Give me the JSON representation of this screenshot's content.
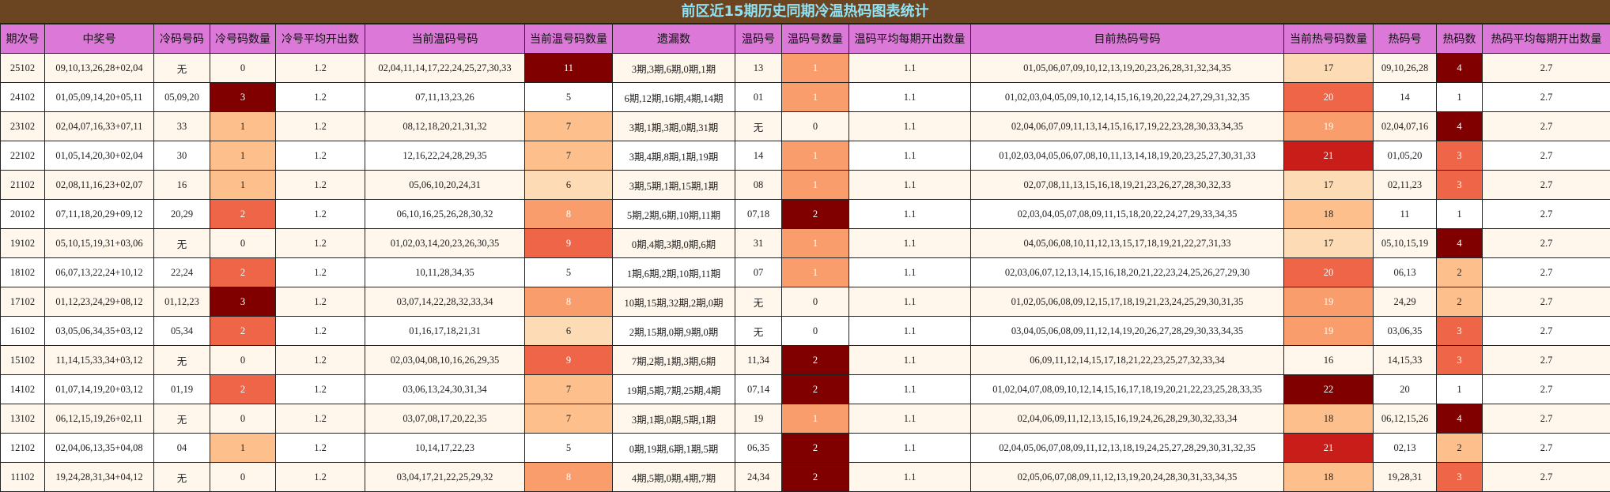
{
  "title": "前区近15期历史同期冷温热码图表统计",
  "headers": [
    "期次号",
    "中奖号",
    "冷码号码",
    "冷号码数量",
    "冷号平均开出数",
    "当前温码号码",
    "当前温号码数量",
    "遗漏数",
    "温码号",
    "温码号数量",
    "温码平均每期开出数量",
    "目前热码号码",
    "当前热号码数量",
    "热码号",
    "热码数",
    "热码平均每期开出数量"
  ],
  "colors": {
    "c1": "#fddcb5",
    "c2": "#fdc08c",
    "c3": "#fa9d6c",
    "c4": "#ee6548",
    "c5": "#c81d19",
    "c6": "#800000",
    "blank": "#ffffff"
  },
  "rows": [
    {
      "issue": "25102",
      "win": "09,10,13,26,28+02,04",
      "cold": "无",
      "cold_n": "0",
      "cold_avg": "1.2",
      "warm": "02,04,11,14,17,22,24,25,27,30,33",
      "warm_n": "11",
      "miss": "3期,3期,6期,0期,1期",
      "wcode": "13",
      "wcode_n": "1",
      "wcode_avg": "1.1",
      "hot": "01,05,06,07,09,10,12,13,19,20,23,26,28,31,32,34,35",
      "hot_n": "17",
      "hcode": "09,10,26,28",
      "hcode_n": "4",
      "hcode_avg": "2.7"
    },
    {
      "issue": "24102",
      "win": "01,05,09,14,20+05,11",
      "cold": "05,09,20",
      "cold_n": "3",
      "cold_avg": "1.2",
      "warm": "07,11,13,23,26",
      "warm_n": "5",
      "miss": "6期,12期,16期,4期,14期",
      "wcode": "01",
      "wcode_n": "1",
      "wcode_avg": "1.1",
      "hot": "01,02,03,04,05,09,10,12,14,15,16,19,20,22,24,27,29,31,32,35",
      "hot_n": "20",
      "hcode": "14",
      "hcode_n": "1",
      "hcode_avg": "2.7"
    },
    {
      "issue": "23102",
      "win": "02,04,07,16,33+07,11",
      "cold": "33",
      "cold_n": "1",
      "cold_avg": "1.2",
      "warm": "08,12,18,20,21,31,32",
      "warm_n": "7",
      "miss": "3期,1期,3期,0期,31期",
      "wcode": "无",
      "wcode_n": "0",
      "wcode_avg": "1.1",
      "hot": "02,04,06,07,09,11,13,14,15,16,17,19,22,23,28,30,33,34,35",
      "hot_n": "19",
      "hcode": "02,04,07,16",
      "hcode_n": "4",
      "hcode_avg": "2.7"
    },
    {
      "issue": "22102",
      "win": "01,05,14,20,30+02,04",
      "cold": "30",
      "cold_n": "1",
      "cold_avg": "1.2",
      "warm": "12,16,22,24,28,29,35",
      "warm_n": "7",
      "miss": "3期,4期,8期,1期,19期",
      "wcode": "14",
      "wcode_n": "1",
      "wcode_avg": "1.1",
      "hot": "01,02,03,04,05,06,07,08,10,11,13,14,18,19,20,23,25,27,30,31,33",
      "hot_n": "21",
      "hcode": "01,05,20",
      "hcode_n": "3",
      "hcode_avg": "2.7"
    },
    {
      "issue": "21102",
      "win": "02,08,11,16,23+02,07",
      "cold": "16",
      "cold_n": "1",
      "cold_avg": "1.2",
      "warm": "05,06,10,20,24,31",
      "warm_n": "6",
      "miss": "3期,5期,1期,15期,1期",
      "wcode": "08",
      "wcode_n": "1",
      "wcode_avg": "1.1",
      "hot": "02,07,08,11,13,15,16,18,19,21,23,26,27,28,30,32,33",
      "hot_n": "17",
      "hcode": "02,11,23",
      "hcode_n": "3",
      "hcode_avg": "2.7"
    },
    {
      "issue": "20102",
      "win": "07,11,18,20,29+09,12",
      "cold": "20,29",
      "cold_n": "2",
      "cold_avg": "1.2",
      "warm": "06,10,16,25,26,28,30,32",
      "warm_n": "8",
      "miss": "5期,2期,6期,10期,11期",
      "wcode": "07,18",
      "wcode_n": "2",
      "wcode_avg": "1.1",
      "hot": "02,03,04,05,07,08,09,11,15,18,20,22,24,27,29,33,34,35",
      "hot_n": "18",
      "hcode": "11",
      "hcode_n": "1",
      "hcode_avg": "2.7"
    },
    {
      "issue": "19102",
      "win": "05,10,15,19,31+03,06",
      "cold": "无",
      "cold_n": "0",
      "cold_avg": "1.2",
      "warm": "01,02,03,14,20,23,26,30,35",
      "warm_n": "9",
      "miss": "0期,4期,3期,0期,6期",
      "wcode": "31",
      "wcode_n": "1",
      "wcode_avg": "1.1",
      "hot": "04,05,06,08,10,11,12,13,15,17,18,19,21,22,27,31,33",
      "hot_n": "17",
      "hcode": "05,10,15,19",
      "hcode_n": "4",
      "hcode_avg": "2.7"
    },
    {
      "issue": "18102",
      "win": "06,07,13,22,24+10,12",
      "cold": "22,24",
      "cold_n": "2",
      "cold_avg": "1.2",
      "warm": "10,11,28,34,35",
      "warm_n": "5",
      "miss": "1期,6期,2期,10期,11期",
      "wcode": "07",
      "wcode_n": "1",
      "wcode_avg": "1.1",
      "hot": "02,03,06,07,12,13,14,15,16,18,20,21,22,23,24,25,26,27,29,30",
      "hot_n": "20",
      "hcode": "06,13",
      "hcode_n": "2",
      "hcode_avg": "2.7"
    },
    {
      "issue": "17102",
      "win": "01,12,23,24,29+08,12",
      "cold": "01,12,23",
      "cold_n": "3",
      "cold_avg": "1.2",
      "warm": "03,07,14,22,28,32,33,34",
      "warm_n": "8",
      "miss": "10期,15期,32期,2期,0期",
      "wcode": "无",
      "wcode_n": "0",
      "wcode_avg": "1.1",
      "hot": "01,02,05,06,08,09,12,15,17,18,19,21,23,24,25,29,30,31,35",
      "hot_n": "19",
      "hcode": "24,29",
      "hcode_n": "2",
      "hcode_avg": "2.7"
    },
    {
      "issue": "16102",
      "win": "03,05,06,34,35+03,12",
      "cold": "05,34",
      "cold_n": "2",
      "cold_avg": "1.2",
      "warm": "01,16,17,18,21,31",
      "warm_n": "6",
      "miss": "2期,15期,0期,9期,0期",
      "wcode": "无",
      "wcode_n": "0",
      "wcode_avg": "1.1",
      "hot": "03,04,05,06,08,09,11,12,14,19,20,26,27,28,29,30,33,34,35",
      "hot_n": "19",
      "hcode": "03,06,35",
      "hcode_n": "3",
      "hcode_avg": "2.7"
    },
    {
      "issue": "15102",
      "win": "11,14,15,33,34+03,12",
      "cold": "无",
      "cold_n": "0",
      "cold_avg": "1.2",
      "warm": "02,03,04,08,10,16,26,29,35",
      "warm_n": "9",
      "miss": "7期,2期,1期,3期,6期",
      "wcode": "11,34",
      "wcode_n": "2",
      "wcode_avg": "1.1",
      "hot": "06,09,11,12,14,15,17,18,21,22,23,25,27,32,33,34",
      "hot_n": "16",
      "hcode": "14,15,33",
      "hcode_n": "3",
      "hcode_avg": "2.7"
    },
    {
      "issue": "14102",
      "win": "01,07,14,19,20+03,12",
      "cold": "01,19",
      "cold_n": "2",
      "cold_avg": "1.2",
      "warm": "03,06,13,24,30,31,34",
      "warm_n": "7",
      "miss": "19期,5期,7期,25期,4期",
      "wcode": "07,14",
      "wcode_n": "2",
      "wcode_avg": "1.1",
      "hot": "01,02,04,07,08,09,10,12,14,15,16,17,18,19,20,21,22,23,25,28,33,35",
      "hot_n": "22",
      "hcode": "20",
      "hcode_n": "1",
      "hcode_avg": "2.7"
    },
    {
      "issue": "13102",
      "win": "06,12,15,19,26+02,11",
      "cold": "无",
      "cold_n": "0",
      "cold_avg": "1.2",
      "warm": "03,07,08,17,20,22,35",
      "warm_n": "7",
      "miss": "3期,1期,0期,5期,1期",
      "wcode": "19",
      "wcode_n": "1",
      "wcode_avg": "1.1",
      "hot": "02,04,06,09,11,12,13,15,16,19,24,26,28,29,30,32,33,34",
      "hot_n": "18",
      "hcode": "06,12,15,26",
      "hcode_n": "4",
      "hcode_avg": "2.7"
    },
    {
      "issue": "12102",
      "win": "02,04,06,13,35+04,08",
      "cold": "04",
      "cold_n": "1",
      "cold_avg": "1.2",
      "warm": "10,14,17,22,23",
      "warm_n": "5",
      "miss": "0期,19期,6期,1期,5期",
      "wcode": "06,35",
      "wcode_n": "2",
      "wcode_avg": "1.1",
      "hot": "02,04,05,06,07,08,09,11,12,13,18,19,24,25,27,28,29,30,31,32,35",
      "hot_n": "21",
      "hcode": "02,13",
      "hcode_n": "2",
      "hcode_avg": "2.7"
    },
    {
      "issue": "11102",
      "win": "19,24,28,31,34+04,12",
      "cold": "无",
      "cold_n": "0",
      "cold_avg": "1.2",
      "warm": "03,04,17,21,22,25,29,32",
      "warm_n": "8",
      "miss": "4期,5期,0期,4期,7期",
      "wcode": "24,34",
      "wcode_n": "2",
      "wcode_avg": "1.1",
      "hot": "02,05,06,07,08,09,11,12,13,19,20,24,28,30,31,33,34,35",
      "hot_n": "18",
      "hcode": "19,28,31",
      "hcode_n": "3",
      "hcode_avg": "2.7"
    }
  ]
}
